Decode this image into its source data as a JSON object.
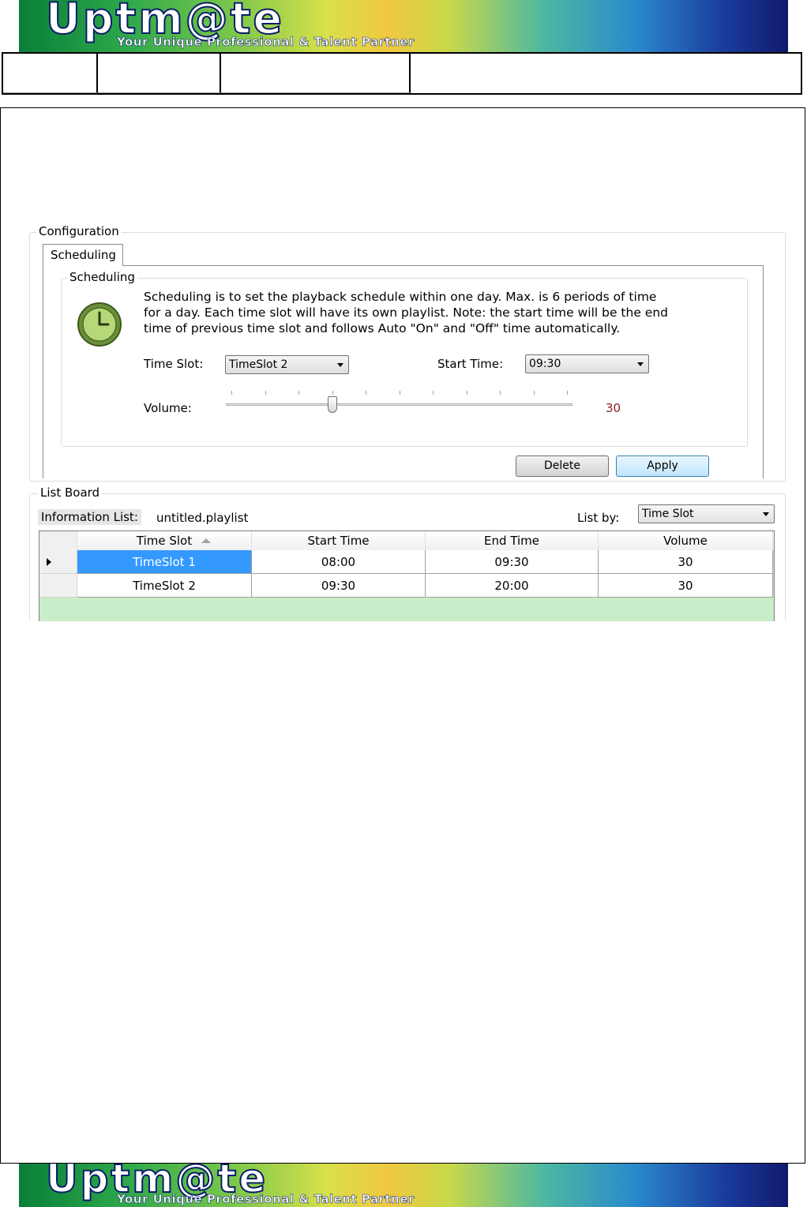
{
  "brand": {
    "logo": "Uptm@te",
    "tagline": "Your Unique Professional & Talent Partner"
  },
  "configuration": {
    "group_title": "Configuration",
    "tab_label": "Scheduling",
    "scheduling": {
      "group_title": "Scheduling",
      "icon": "clock-icon",
      "description_line1": "Scheduling is to set the playback schedule within one day. Max. is 6 periods of time",
      "description_line2": "for a day. Each time slot will have its own playlist. Note: the start time will be the end",
      "description_line3": "time of previous time slot and follows Auto \"On\" and \"Off\" time automatically.",
      "time_slot_label": "Time Slot:",
      "time_slot_value": "TimeSlot 2",
      "start_time_label": "Start Time:",
      "start_time_value": "09:30",
      "volume_label": "Volume:",
      "volume_value": "30",
      "volume_fraction": 0.3
    },
    "buttons": {
      "delete": "Delete",
      "apply": "Apply"
    }
  },
  "list_board": {
    "group_title": "List Board",
    "info_label": "Information List:",
    "info_value": "untitled.playlist",
    "list_by_label": "List by:",
    "list_by_value": "Time Slot",
    "columns": [
      "Time Slot",
      "Start Time",
      "End Time",
      "Volume"
    ],
    "rows": [
      {
        "time_slot": "TimeSlot 1",
        "start_time": "08:00",
        "end_time": "09:30",
        "volume": "30",
        "selected": true
      },
      {
        "time_slot": "TimeSlot 2",
        "start_time": "09:30",
        "end_time": "20:00",
        "volume": "30",
        "selected": false
      }
    ]
  },
  "colors": {
    "selection": "#3399ff",
    "volume_value": "#8b1a1a",
    "grid_empty": "#c9ecc9"
  }
}
